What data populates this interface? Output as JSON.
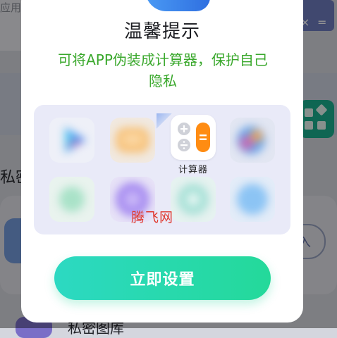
{
  "background": {
    "top_text": "应用",
    "section_text": "私密",
    "right_button_text": "入",
    "bottom_text": "私密图库",
    "top_icon_glyphs": [
      "×",
      "="
    ]
  },
  "dialog": {
    "title": "温馨提示",
    "subtitle": "可将APP伪装成计算器，保护自己隐私",
    "calculator_label": "计算器",
    "watermark": "腾飞网",
    "cta_label": "立即设置"
  },
  "colors": {
    "accent_green": "#3aa82c",
    "cta_start": "#2cd9c2",
    "cta_end": "#24d99a",
    "calc_orange": "#ff8c12"
  },
  "apps": [
    {
      "icon": "google-play-icon",
      "blurred": true
    },
    {
      "icon": "orange-mail-icon",
      "blurred": true
    },
    {
      "icon": "calculator-icon",
      "blurred": false
    },
    {
      "icon": "colorful-orb-icon",
      "blurred": true
    },
    {
      "icon": "green-app-icon",
      "blurred": true
    },
    {
      "icon": "purple-app-icon",
      "blurred": true
    },
    {
      "icon": "teal-app-icon",
      "blurred": true
    },
    {
      "icon": "blue-app-icon",
      "blurred": true
    }
  ]
}
